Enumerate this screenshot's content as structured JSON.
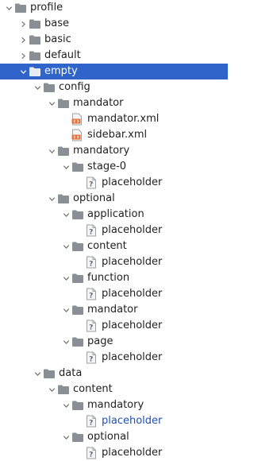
{
  "tree": [
    {
      "label": "profile",
      "depth": 0,
      "type": "folder",
      "expanded": true
    },
    {
      "label": "base",
      "depth": 1,
      "type": "folder",
      "expanded": false
    },
    {
      "label": "basic",
      "depth": 1,
      "type": "folder",
      "expanded": false
    },
    {
      "label": "default",
      "depth": 1,
      "type": "folder",
      "expanded": false
    },
    {
      "label": "empty",
      "depth": 1,
      "type": "folder",
      "expanded": true,
      "selected": true
    },
    {
      "label": "config",
      "depth": 2,
      "type": "folder",
      "expanded": true
    },
    {
      "label": "mandator",
      "depth": 3,
      "type": "folder",
      "expanded": true
    },
    {
      "label": "mandator.xml",
      "depth": 4,
      "type": "xml"
    },
    {
      "label": "sidebar.xml",
      "depth": 4,
      "type": "xml"
    },
    {
      "label": "mandatory",
      "depth": 3,
      "type": "folder",
      "expanded": true
    },
    {
      "label": "stage-0",
      "depth": 4,
      "type": "folder",
      "expanded": true
    },
    {
      "label": "placeholder",
      "depth": 5,
      "type": "unknown"
    },
    {
      "label": "optional",
      "depth": 3,
      "type": "folder",
      "expanded": true
    },
    {
      "label": "application",
      "depth": 4,
      "type": "folder",
      "expanded": true
    },
    {
      "label": "placeholder",
      "depth": 5,
      "type": "unknown"
    },
    {
      "label": "content",
      "depth": 4,
      "type": "folder",
      "expanded": true
    },
    {
      "label": "placeholder",
      "depth": 5,
      "type": "unknown"
    },
    {
      "label": "function",
      "depth": 4,
      "type": "folder",
      "expanded": true
    },
    {
      "label": "placeholder",
      "depth": 5,
      "type": "unknown"
    },
    {
      "label": "mandator",
      "depth": 4,
      "type": "folder",
      "expanded": true
    },
    {
      "label": "placeholder",
      "depth": 5,
      "type": "unknown"
    },
    {
      "label": "page",
      "depth": 4,
      "type": "folder",
      "expanded": true
    },
    {
      "label": "placeholder",
      "depth": 5,
      "type": "unknown"
    },
    {
      "label": "data",
      "depth": 2,
      "type": "folder",
      "expanded": true
    },
    {
      "label": "content",
      "depth": 3,
      "type": "folder",
      "expanded": true
    },
    {
      "label": "mandatory",
      "depth": 4,
      "type": "folder",
      "expanded": true
    },
    {
      "label": "placeholder",
      "depth": 5,
      "type": "unknown",
      "highlight": true
    },
    {
      "label": "optional",
      "depth": 4,
      "type": "folder",
      "expanded": true
    },
    {
      "label": "placeholder",
      "depth": 5,
      "type": "unknown"
    }
  ],
  "colors": {
    "selection": "#2f65ca",
    "folder": "#8a8f96",
    "xml": "#e8703a",
    "link_text": "#1f4fb5"
  }
}
